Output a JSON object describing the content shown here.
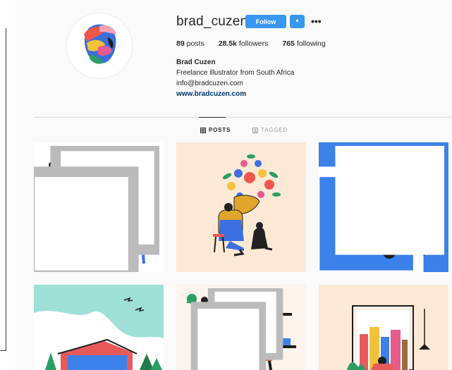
{
  "profile": {
    "username": "brad_cuzen",
    "follow_label": "Follow",
    "more_glyph": "•••",
    "stats": {
      "posts": "89",
      "posts_label": "posts",
      "followers": "28.5k",
      "followers_label": "followers",
      "following": "765",
      "following_label": "following"
    },
    "bio": {
      "full_name": "Brad Cuzen",
      "description": "Freelance illustrator from South Africa",
      "email": "info@bradcuzen.com",
      "website": "www.bradcuzen.com"
    }
  },
  "tabs": [
    {
      "label": "POSTS",
      "icon": "grid-icon",
      "active": true
    },
    {
      "label": "TAGGED",
      "icon": "tag-icon",
      "active": false
    }
  ],
  "posts": [
    {
      "name": "post-studio-vignettes",
      "multi": true
    },
    {
      "name": "post-tuba-player",
      "multi": false
    },
    {
      "name": "post-city-shop-scooter",
      "multi": true
    },
    {
      "name": "post-sky-landscape",
      "multi": false
    },
    {
      "name": "post-cooking-vignettes",
      "multi": true
    },
    {
      "name": "post-window-city",
      "multi": false
    }
  ],
  "colors": {
    "accent": "#3897f0",
    "link": "#003569",
    "tile_blue": "#3c80ea",
    "tile_cream": "#fbe9d6",
    "tile_teal": "#9ee0d6"
  }
}
